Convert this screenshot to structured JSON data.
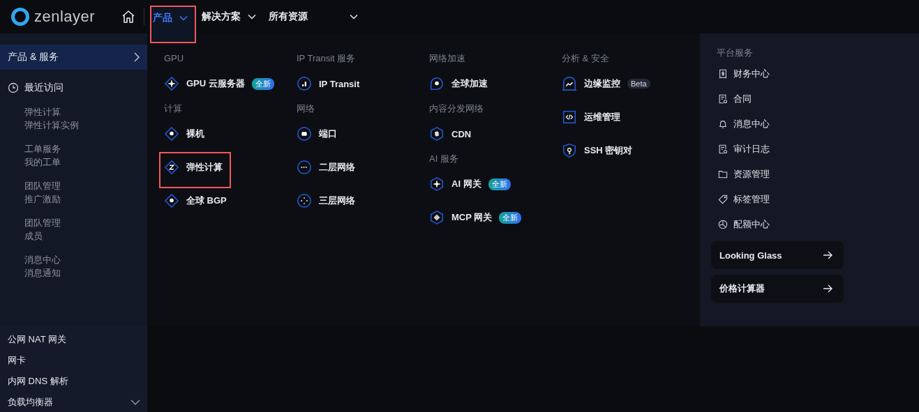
{
  "brand": {
    "name": "zenlayer"
  },
  "nav": [
    {
      "label": "产品",
      "selected": true,
      "annotated": true
    },
    {
      "label": "解决方案",
      "selected": false,
      "annotated": false
    },
    {
      "label": "所有资源",
      "selected": false,
      "annotated": false
    }
  ],
  "mega_menu": {
    "sidebar": {
      "section": {
        "label": "产品 & 服务",
        "selected": true
      },
      "recent": {
        "title": "最近访问",
        "entries": [
          {
            "category": "弹性计算",
            "page": "弹性计算实例"
          },
          {
            "category": "工单服务",
            "page": "我的工单"
          },
          {
            "category": "团队管理",
            "page": "推广激励"
          },
          {
            "category": "团队管理",
            "page": "成员"
          },
          {
            "category": "消息中心",
            "page": "消息通知"
          }
        ]
      }
    },
    "columns": [
      {
        "sections": [
          {
            "title": "GPU",
            "items": [
              {
                "label": "GPU 云服务器",
                "badge": {
                  "text": "全新",
                  "kind": "new"
                },
                "annotated": false
              }
            ]
          },
          {
            "title": "计算",
            "items": [
              {
                "label": "裸机",
                "annotated": false
              },
              {
                "label": "弹性计算",
                "annotated": true
              },
              {
                "label": "全球 BGP",
                "annotated": false
              }
            ]
          }
        ]
      },
      {
        "sections": [
          {
            "title": "IP Transit 服务",
            "items": [
              {
                "label": "IP Transit",
                "annotated": false
              }
            ]
          },
          {
            "title": "网络",
            "items": [
              {
                "label": "端口",
                "annotated": false
              },
              {
                "label": "二层网络",
                "annotated": false
              },
              {
                "label": "三层网络",
                "annotated": false
              }
            ]
          }
        ]
      },
      {
        "sections": [
          {
            "title": "网络加速",
            "items": [
              {
                "label": "全球加速",
                "annotated": false
              }
            ]
          },
          {
            "title": "内容分发网络",
            "items": [
              {
                "label": "CDN",
                "annotated": false
              }
            ]
          },
          {
            "title": "AI 服务",
            "items": [
              {
                "label": "AI 网关",
                "badge": {
                  "text": "全新",
                  "kind": "new"
                },
                "annotated": false
              },
              {
                "label": "MCP 网关",
                "badge": {
                  "text": "全新",
                  "kind": "new"
                },
                "annotated": false
              }
            ]
          }
        ]
      },
      {
        "sections": [
          {
            "title": "分析 & 安全",
            "items": [
              {
                "label": "边缘监控",
                "badge": {
                  "text": "Beta",
                  "kind": "beta"
                },
                "annotated": false
              },
              {
                "label": "运维管理",
                "annotated": false
              },
              {
                "label": "SSH 密钥对",
                "annotated": false
              }
            ]
          }
        ]
      }
    ],
    "platform": {
      "title": "平台服务",
      "items": [
        {
          "label": "财务中心"
        },
        {
          "label": "合同"
        },
        {
          "label": "消息中心"
        },
        {
          "label": "审计日志"
        },
        {
          "label": "资源管理"
        },
        {
          "label": "标签管理"
        },
        {
          "label": "配额中心"
        }
      ],
      "links": [
        {
          "label": "Looking Glass"
        },
        {
          "label": "价格计算器"
        }
      ]
    }
  },
  "page_sidebar": {
    "items": [
      {
        "label": "公网 NAT 网关",
        "kind": "link"
      },
      {
        "label": "网卡",
        "kind": "link"
      },
      {
        "label": "内网 DNS 解析",
        "kind": "link"
      },
      {
        "label": "负载均衡器",
        "kind": "group"
      }
    ]
  }
}
